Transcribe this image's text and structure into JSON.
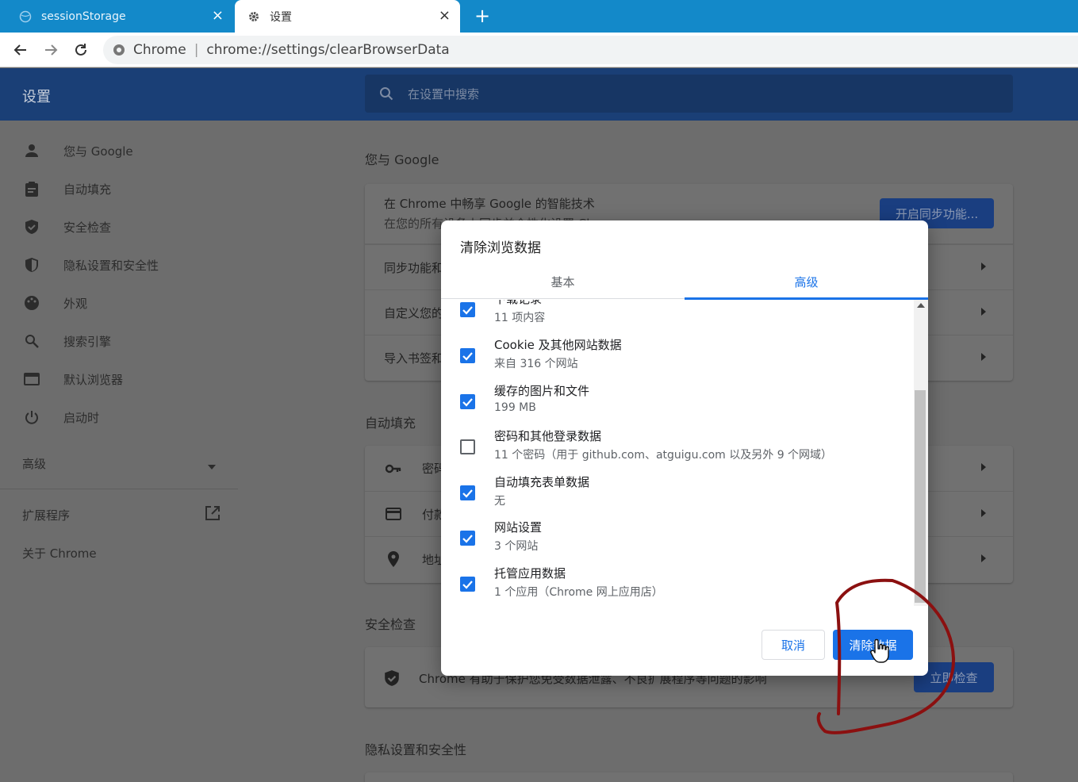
{
  "browser": {
    "tabs": [
      {
        "label": "sessionStorage",
        "close": "×"
      },
      {
        "label": "设置",
        "close": "×"
      }
    ],
    "new_tab": "+",
    "omnibox": {
      "site": "Chrome",
      "separator": "|",
      "url": "chrome://settings/clearBrowserData"
    }
  },
  "settings": {
    "title": "设置",
    "search_placeholder": "在设置中搜索",
    "sidebar": [
      {
        "label": "您与 Google",
        "icon": "person-icon"
      },
      {
        "label": "自动填充",
        "icon": "clipboard-icon"
      },
      {
        "label": "安全检查",
        "icon": "shield-check-icon"
      },
      {
        "label": "隐私设置和安全性",
        "icon": "shield-icon"
      },
      {
        "label": "外观",
        "icon": "palette-icon"
      },
      {
        "label": "搜索引擎",
        "icon": "search-icon"
      },
      {
        "label": "默认浏览器",
        "icon": "browser-icon"
      },
      {
        "label": "启动时",
        "icon": "power-icon"
      }
    ],
    "advanced": "高级",
    "extensions": "扩展程序",
    "about": "关于 Chrome",
    "sections": {
      "you_google": {
        "title": "您与 Google",
        "sync_line1": "在 Chrome 中畅享 Google 的智能技术",
        "sync_line2": "在您的所有设备上同步并个性化设置 Chrome",
        "sync_button": "开启同步功能...",
        "rows": [
          "同步功能和 Google 服务",
          "自定义您的 Chrome 个人资料",
          "导入书签和设置"
        ]
      },
      "autofill": {
        "title": "自动填充",
        "rows": [
          "密码",
          "付款方式",
          "地址和其他信息"
        ]
      },
      "safety": {
        "title": "安全检查",
        "text": "Chrome 有助于保护您免受数据泄露、不良扩展程序等问题的影响",
        "button": "立即检查"
      },
      "privacy": {
        "title": "隐私设置和安全性"
      }
    }
  },
  "dialog": {
    "title": "清除浏览数据",
    "tabs": [
      "基本",
      "高级"
    ],
    "active_tab": "高级",
    "items": [
      {
        "title": "下载记录",
        "subtitle": "11 项内容",
        "checked": true
      },
      {
        "title": "Cookie 及其他网站数据",
        "subtitle": "来自 316 个网站",
        "checked": true
      },
      {
        "title": "缓存的图片和文件",
        "subtitle": "199 MB",
        "checked": true
      },
      {
        "title": "密码和其他登录数据",
        "subtitle": "11 个密码（用于 github.com、atguigu.com 以及另外 9 个网域）",
        "checked": false
      },
      {
        "title": "自动填充表单数据",
        "subtitle": "无",
        "checked": true
      },
      {
        "title": "网站设置",
        "subtitle": "3 个网站",
        "checked": true
      },
      {
        "title": "托管应用数据",
        "subtitle": "1 个应用（Chrome 网上应用店）",
        "checked": true
      }
    ],
    "cancel_label": "取消",
    "clear_label": "清除数据"
  },
  "colors": {
    "accent": "#1a73e8",
    "tabstrip": "#1389c9",
    "annotation": "#8b1010"
  }
}
